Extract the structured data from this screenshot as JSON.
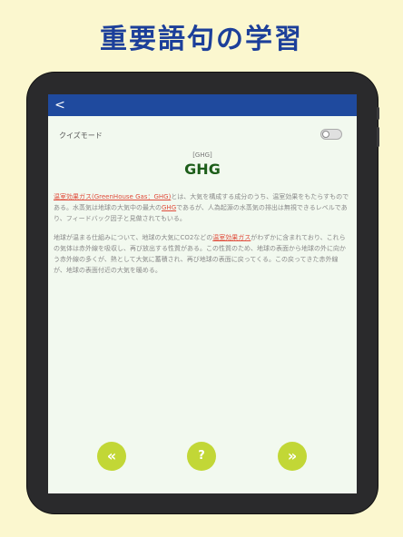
{
  "headline": "重要語句の学習",
  "navbar": {
    "back_symbol": "<"
  },
  "quiz": {
    "label": "クイズモード",
    "toggle_on": false
  },
  "term": {
    "reading": "[GHG]",
    "word": "GHG"
  },
  "paragraph1": {
    "link1": "温室効果ガス(GreenHouse Gas：GHG)",
    "text1": "とは、大気を構成する成分のうち、温室効果をもたらすものである。水蒸気は地球の大気中の最大の",
    "link2": "GHG",
    "text2": "であるが、人為起源の水蒸気の排出は無視できるレベルであり、フィードバック因子と見做されてもいる。"
  },
  "paragraph2": {
    "text1": "地球が温まる仕組みについて、地球の大気にCO2などの",
    "link1": "温室効果ガス",
    "text2": "がわずかに含まれており、これらの気体は赤外線を吸収し、再び放出する性質がある。この性質のため、地球の表面から地球の外に向かう赤外線の多くが、熱として大気に蓄積され、再び地球の表面に戻ってくる。この戻ってきた赤外線が、地球の表面付近の大気を暖める。"
  },
  "controls": {
    "prev_symbol": "«",
    "hint_symbol": "?",
    "next_symbol": "»"
  },
  "colors": {
    "accent": "#1f4a9e",
    "button": "#c2d736",
    "term": "#1d5e1a",
    "link": "#e04b3a"
  }
}
